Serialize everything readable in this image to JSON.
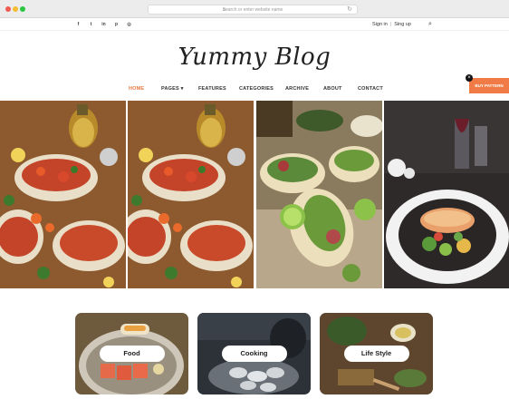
{
  "browser": {
    "url_placeholder": "Search or enter website name"
  },
  "topbar": {
    "social_icons": [
      "facebook-icon",
      "twitter-icon",
      "linkedin-icon",
      "pinterest-icon",
      "instagram-icon"
    ],
    "social_glyphs": [
      "f",
      "t",
      "in",
      "p",
      "◎"
    ],
    "signin": "Sign in",
    "signup": "Sing up"
  },
  "site": {
    "logo": "Yummy Blog"
  },
  "nav": {
    "items": [
      {
        "label": "HOME",
        "active": true
      },
      {
        "label": "PAGES ▾",
        "active": false
      },
      {
        "label": "FEATURES",
        "active": false
      },
      {
        "label": "CATEGORIES",
        "active": false
      },
      {
        "label": "ARCHIVE",
        "active": false
      },
      {
        "label": "ABOUT",
        "active": false
      },
      {
        "label": "CONTACT",
        "active": false
      }
    ],
    "buy_label": "BUY PATTERN"
  },
  "categories": [
    {
      "label": "Food"
    },
    {
      "label": "Cooking"
    },
    {
      "label": "Life Style"
    }
  ],
  "colors": {
    "accent": "#f07b47",
    "active_nav": "#e8793d"
  }
}
